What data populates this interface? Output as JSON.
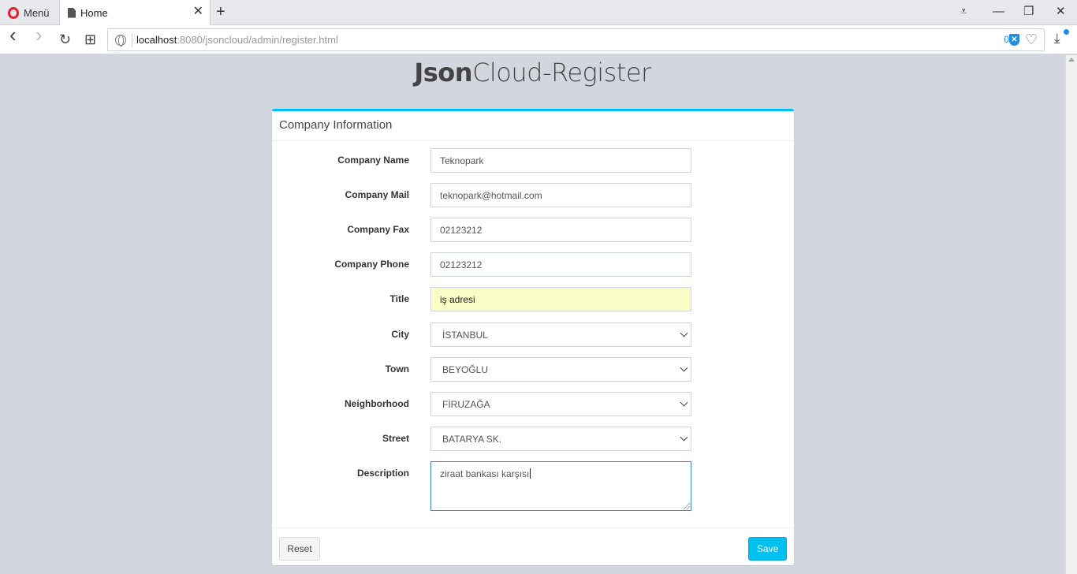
{
  "browser": {
    "menu_label": "Menü",
    "tab_title": "Home",
    "tab_close": "✕",
    "new_tab": "+",
    "url_host": "localhost",
    "url_rest": ":8080/jsoncloud/admin/register.html",
    "tracker_count": "0",
    "shield_glyph": "✕",
    "heart_glyph": "♡",
    "download_glyph": "⤓",
    "back_glyph": "‹",
    "forward_glyph": "›",
    "reload_glyph": "↻",
    "speeddial_glyph": "⊞",
    "easysetup_glyph": "⩡",
    "minimize_glyph": "—",
    "restore_glyph": "❐",
    "close_glyph": "✕"
  },
  "page": {
    "title_bold": "Json",
    "title_rest": "Cloud-Register"
  },
  "form": {
    "header": "Company Information",
    "fields": [
      {
        "label": "Company Name",
        "value": "Teknopark"
      },
      {
        "label": "Company Mail",
        "value": "teknopark@hotmail.com"
      },
      {
        "label": "Company Fax",
        "value": "02123212"
      },
      {
        "label": "Company Phone",
        "value": "02123212"
      },
      {
        "label": "Title",
        "value": "iş adresi"
      },
      {
        "label": "City",
        "value": "İSTANBUL"
      },
      {
        "label": "Town",
        "value": "BEYOĞLU"
      },
      {
        "label": "Neighborhood",
        "value": "FİRUZAĞA"
      },
      {
        "label": "Street",
        "value": "BATARYA SK."
      },
      {
        "label": "Description",
        "value": "ziraat bankası karşısı"
      }
    ],
    "reset_label": "Reset",
    "save_label": "Save"
  },
  "colors": {
    "accent": "#00c0ef",
    "autofill": "#fafdc5",
    "page_bg": "#d2d6de"
  }
}
